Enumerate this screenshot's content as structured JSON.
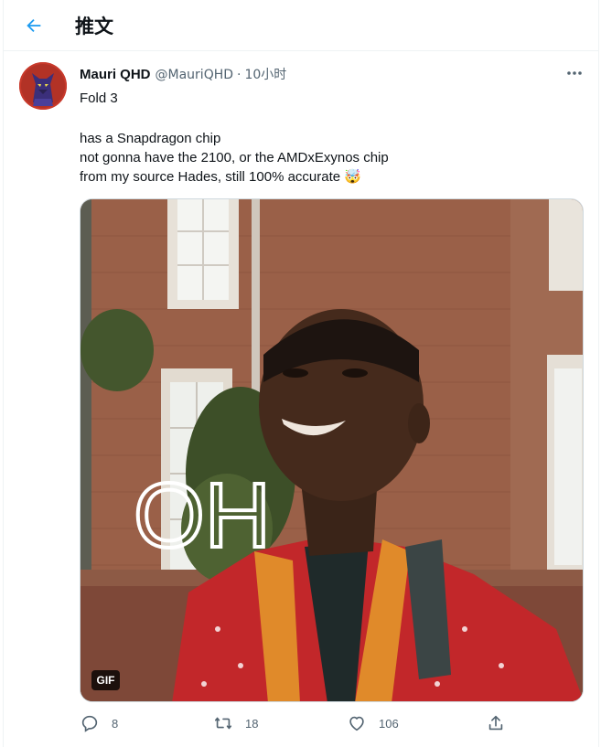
{
  "header": {
    "title": "推文"
  },
  "tweet": {
    "display_name": "Mauri QHD",
    "handle": "@MauriQHD",
    "separator": "·",
    "time": "10小时",
    "lines": [
      "Fold 3",
      "has a Snapdragon chip",
      "not gonna have the 2100, or the AMDxExynos chip",
      "from my source Hades, still 100% accurate 🤯"
    ],
    "media": {
      "overlay_text": "OH",
      "badge": "GIF"
    },
    "stats": {
      "replies": "8",
      "retweets": "18",
      "likes": "106"
    }
  },
  "colors": {
    "accent": "#1d9bf0",
    "muted": "#536471",
    "border": "#eff3f4"
  }
}
